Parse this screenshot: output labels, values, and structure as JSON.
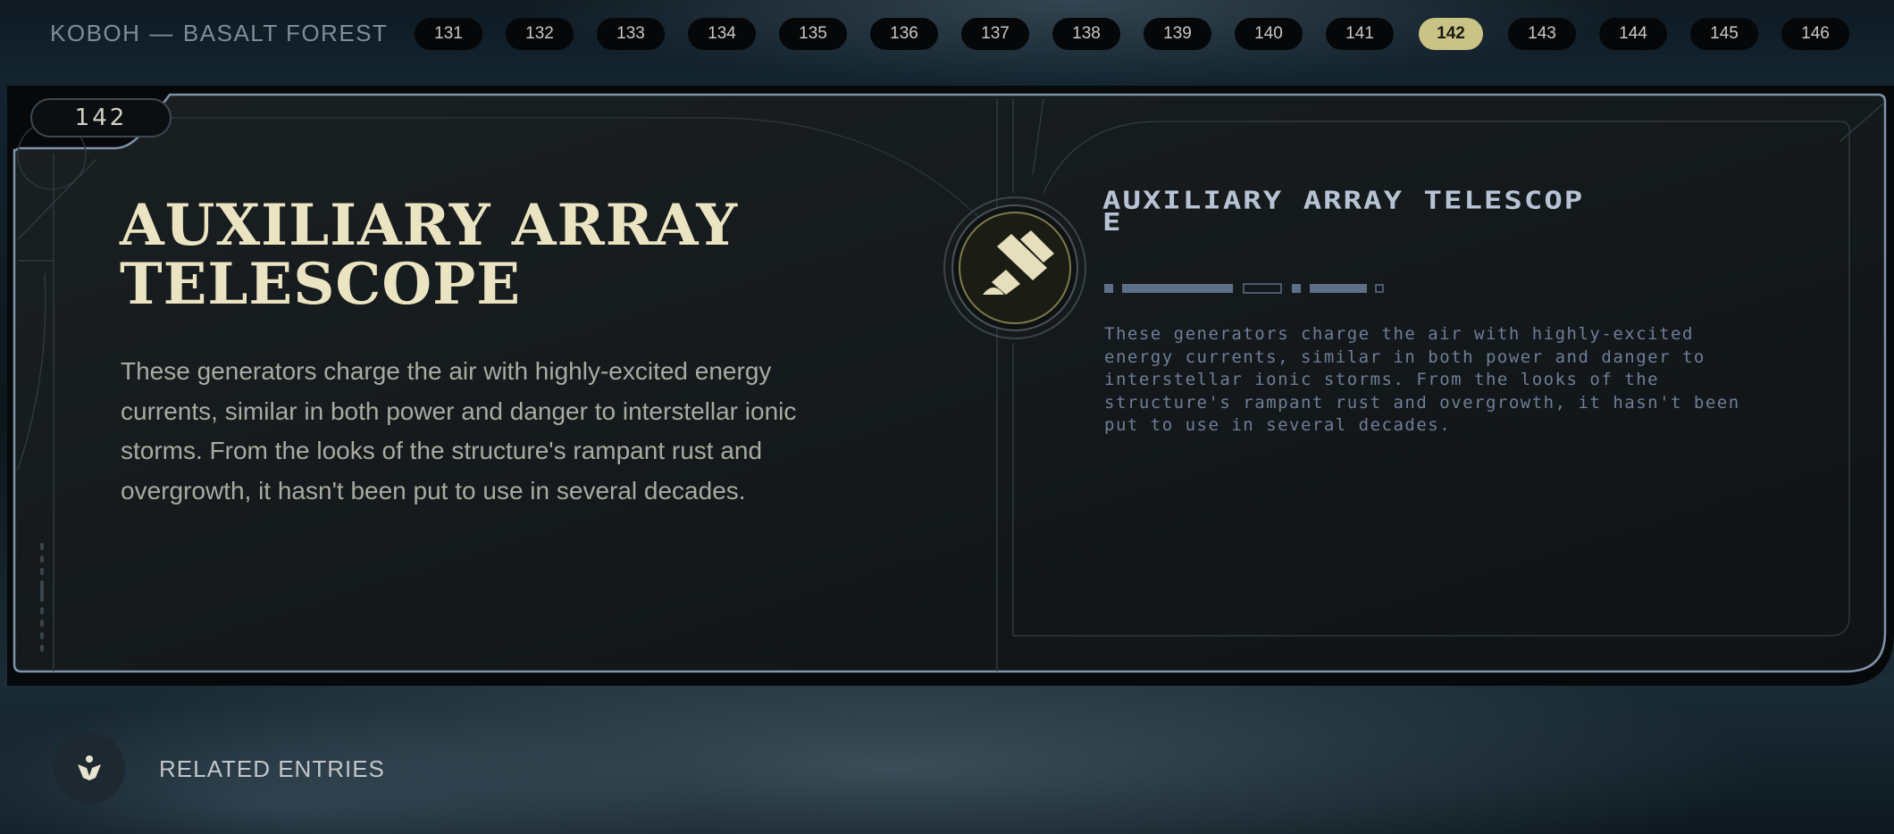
{
  "header": {
    "planet": "KOBOH",
    "separator": "—",
    "region": "BASALT FOREST"
  },
  "pagination": {
    "pages": [
      "131",
      "132",
      "133",
      "134",
      "135",
      "136",
      "137",
      "138",
      "139",
      "140",
      "141",
      "142",
      "143",
      "144",
      "145",
      "146"
    ],
    "active_page": "142"
  },
  "entry": {
    "number": "142",
    "title": "AUXILIARY ARRAY TELESCOPE",
    "description": "These generators charge the air with highly-excited energy currents, similar in both power and danger to interstellar ionic storms. From the looks of the structure's rampant rust and overgrowth, it hasn't been put to use in several decades.",
    "emblem_icon": "databank-emblem-icon",
    "aurebesh_title": "AUXILIARY ARRAY TELESCOPE",
    "aurebesh_text": "These generators charge the air with highly-excited energy currents, similar in both power and danger to interstellar ionic storms. From the looks of the structure's rampant rust and overgrowth, it hasn't been put to use in several decades."
  },
  "related": {
    "label": "RELATED ENTRIES",
    "icon": "related-entries-icon"
  },
  "colors": {
    "accent": "#c9c386",
    "title": "#ebe4c2",
    "panel": "#14191c",
    "panel_border": "#7f93aa",
    "aurebesh": "#6f7e98"
  }
}
